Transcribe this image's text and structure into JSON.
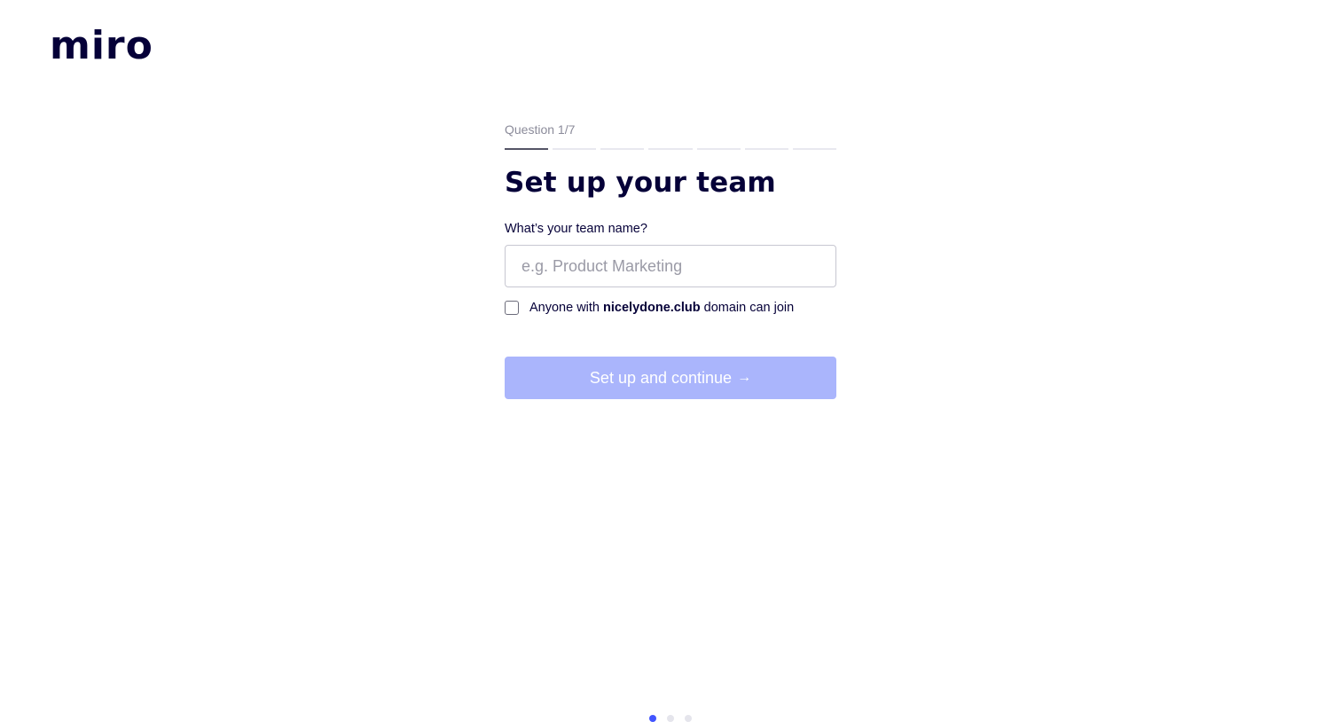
{
  "brand": {
    "logo_text": "miro"
  },
  "onboarding": {
    "question_counter": "Question 1/7",
    "progress": {
      "current_step": 1,
      "total_steps": 7
    },
    "title": "Set up your team",
    "team_name_label": "What’s your team name?",
    "team_name_placeholder": "e.g. Product Marketing",
    "team_name_value": "",
    "domain_join": {
      "prefix": "Anyone with ",
      "domain": "nicelydone.club",
      "suffix": " domain can join",
      "checked": false
    },
    "continue_button": {
      "label": "Set up and continue",
      "icon": "arrow-right-icon",
      "glyph": "→",
      "enabled": false
    }
  },
  "pagination": {
    "current_page": 1,
    "total_pages": 3
  },
  "colors": {
    "brand_text": "#050038",
    "button_disabled": "#aab5fc",
    "dot_active": "#4255ff"
  }
}
